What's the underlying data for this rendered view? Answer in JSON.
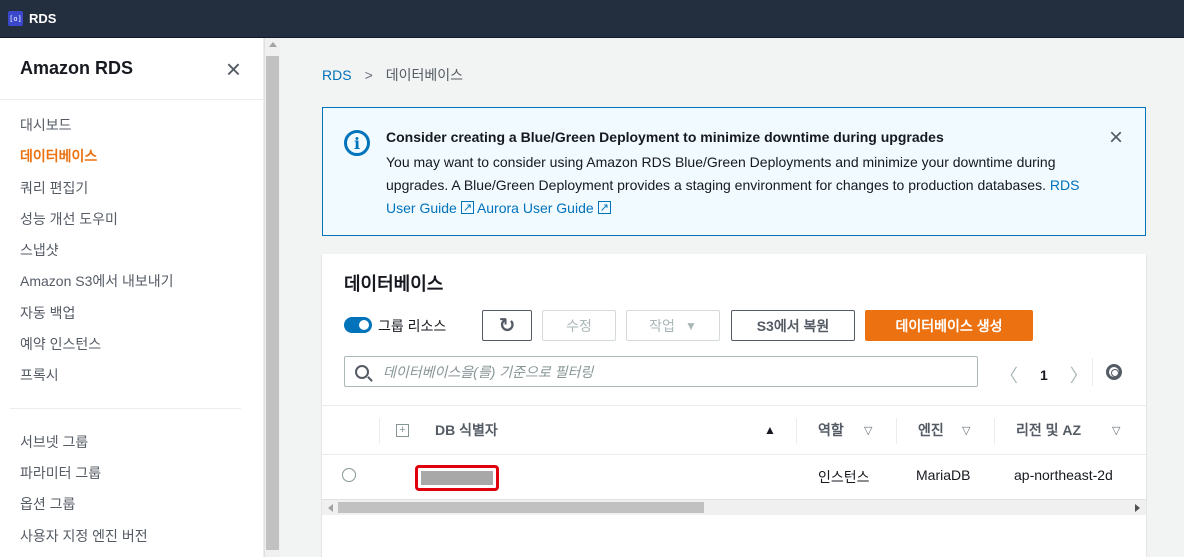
{
  "topbar": {
    "logo_text": "[o]",
    "title": "RDS"
  },
  "sidebar": {
    "title": "Amazon RDS",
    "close": "×",
    "items": [
      {
        "label": "대시보드",
        "active": false
      },
      {
        "label": "데이터베이스",
        "active": true
      },
      {
        "label": "쿼리 편집기",
        "active": false
      },
      {
        "label": "성능 개선 도우미",
        "active": false
      },
      {
        "label": "스냅샷",
        "active": false
      },
      {
        "label": "Amazon S3에서 내보내기",
        "active": false
      },
      {
        "label": "자동 백업",
        "active": false
      },
      {
        "label": "예약 인스턴스",
        "active": false
      },
      {
        "label": "프록시",
        "active": false
      }
    ],
    "items2": [
      {
        "label": "서브넷 그룹"
      },
      {
        "label": "파라미터 그룹"
      },
      {
        "label": "옵션 그룹"
      },
      {
        "label": "사용자 지정 엔진 버전"
      }
    ]
  },
  "breadcrumb": {
    "root": "RDS",
    "separator": ">",
    "current": "데이터베이스"
  },
  "flash": {
    "icon": "i",
    "title": "Consider creating a Blue/Green Deployment to minimize downtime during upgrades",
    "body": "You may want to consider using Amazon RDS Blue/Green Deployments and minimize your downtime during upgrades. A Blue/Green Deployment provides a staging environment for changes to production databases.",
    "link1": "RDS User Guide",
    "link2": "Aurora User Guide",
    "close": "×"
  },
  "panel": {
    "title": "데이터베이스",
    "toggle_label": "그룹 리소스",
    "refresh": "↻",
    "modify": "수정",
    "actions": "작업",
    "actions_caret": "▼",
    "restore_s3": "S3에서 복원",
    "create": "데이터베이스 생성",
    "search_placeholder": "데이터베이스을(를) 기준으로 필터링",
    "page": "1",
    "prev": "〈",
    "next": "〉"
  },
  "table": {
    "expand": "+",
    "columns": {
      "id": "DB 식별자",
      "id_sort": "▲",
      "role": "역할",
      "engine": "엔진",
      "region": "리전 및 AZ",
      "filter": "▽"
    },
    "rows": [
      {
        "role": "인스턴스",
        "engine": "MariaDB",
        "region": "ap-northeast-2d"
      }
    ]
  },
  "colors": {
    "accent": "#ec7211",
    "link": "#0073bb",
    "header": "#232f3e",
    "redact_border": "#e0000b"
  }
}
